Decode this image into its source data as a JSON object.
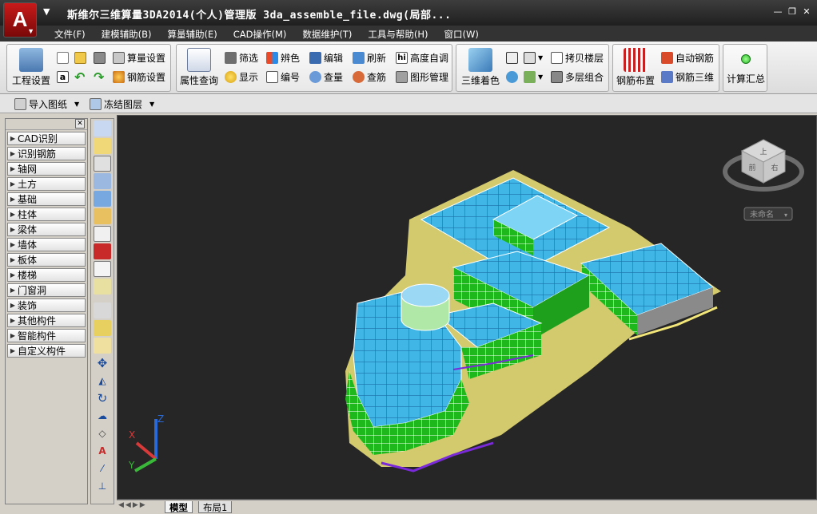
{
  "app": {
    "title": "斯维尔三维算量3DA2014(个人)管理版      3da_assemble_file.dwg(局部...",
    "logo_letter": "A"
  },
  "menu": [
    "文件(F)",
    "建模辅助(B)",
    "算量辅助(E)",
    "CAD操作(M)",
    "数据维护(T)",
    "工具与帮助(H)",
    "窗口(W)"
  ],
  "ribbon": {
    "project_settings": "工程设置",
    "calc_settings": "算量设置",
    "rebar_settings": "钢筋设置",
    "property_query": "属性查询",
    "filter": "筛选",
    "distinguish_color": "辨色",
    "edit": "编辑",
    "refresh": "刷新",
    "height_adjust": "高度自调",
    "show": "显示",
    "number": "编号",
    "check_quantity": "查量",
    "check_rebar": "查筋",
    "graphics_manage": "图形管理",
    "three_d_color": "三维着色",
    "copy_floor": "拷贝楼层",
    "multi_floor": "多层组合",
    "rebar_layout": "钢筋布置",
    "auto_rebar": "自动钢筋",
    "rebar_3d": "钢筋三维",
    "calc_summary": "计算汇总"
  },
  "subbar": {
    "import_drawing": "导入图纸",
    "freeze_layer": "冻结图层"
  },
  "categories": [
    "CAD识别",
    "识别钢筋",
    "轴网",
    "土方",
    "基础",
    "柱体",
    "梁体",
    "墙体",
    "板体",
    "楼梯",
    "门窗洞",
    "装饰",
    "其他构件",
    "智能构件",
    "自定义构件"
  ],
  "viewcube": {
    "top_label": "上",
    "right_label": "右",
    "front_label": "前",
    "named_view": "未命名"
  },
  "ucs": {
    "x": "X",
    "y": "Y",
    "z": "Z"
  },
  "tabs": {
    "model": "模型",
    "layout1": "布局1"
  },
  "colors": {
    "titlebar": "#2b2b2b",
    "viewport": "#262626",
    "slab": "#3fb6e6",
    "walls": "#22c81e",
    "base": "#f2e67a"
  }
}
